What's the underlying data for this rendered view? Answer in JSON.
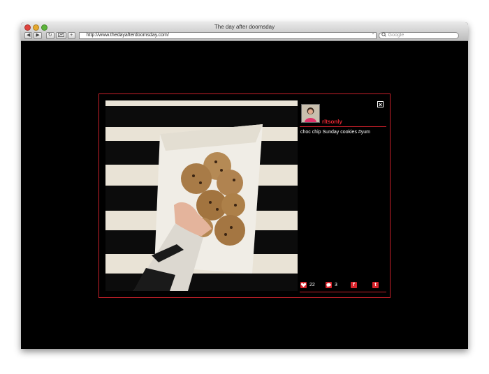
{
  "browser": {
    "title": "The day after doomsday",
    "url": "http://www.thedayafterdoomsday.com/",
    "search_placeholder": "Google",
    "buttons": {
      "back": "◀",
      "forward": "▶",
      "reload": "↻",
      "add": "+"
    }
  },
  "post": {
    "username": "rltsonly",
    "caption": "choc chip Sunday cookies #yum",
    "close_label": "×",
    "likes": "22",
    "comments": "3",
    "facebook_label": "f",
    "twitter_label": "t"
  },
  "colors": {
    "accent": "#d8242c",
    "background": "#000000"
  }
}
